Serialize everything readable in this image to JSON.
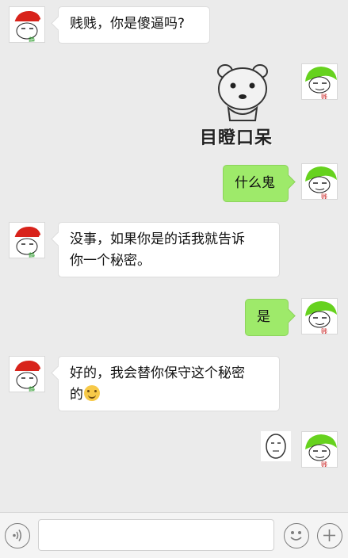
{
  "messages": [
    {
      "side": "left",
      "text": "贱贱，你是傻逼吗?"
    },
    {
      "side": "right",
      "type": "sticker",
      "caption": "目瞪口呆"
    },
    {
      "side": "right",
      "text": "什么鬼"
    },
    {
      "side": "left",
      "lines": [
        "没事，如果你是的话我就告诉",
        "你一个秘密。"
      ]
    },
    {
      "side": "right",
      "text": "是"
    },
    {
      "side": "left",
      "lines": [
        "好的，我会替你保守这个秘密",
        "的"
      ]
    },
    {
      "side": "right",
      "type": "sticker",
      "caption": ""
    }
  ],
  "avatars": {
    "left": {
      "label": "静"
    },
    "right": {
      "label": "贱"
    }
  },
  "input_bar": {
    "voice_icon": "voice-icon",
    "emoji_icon": "emoji-icon",
    "plus_icon": "plus-icon"
  }
}
